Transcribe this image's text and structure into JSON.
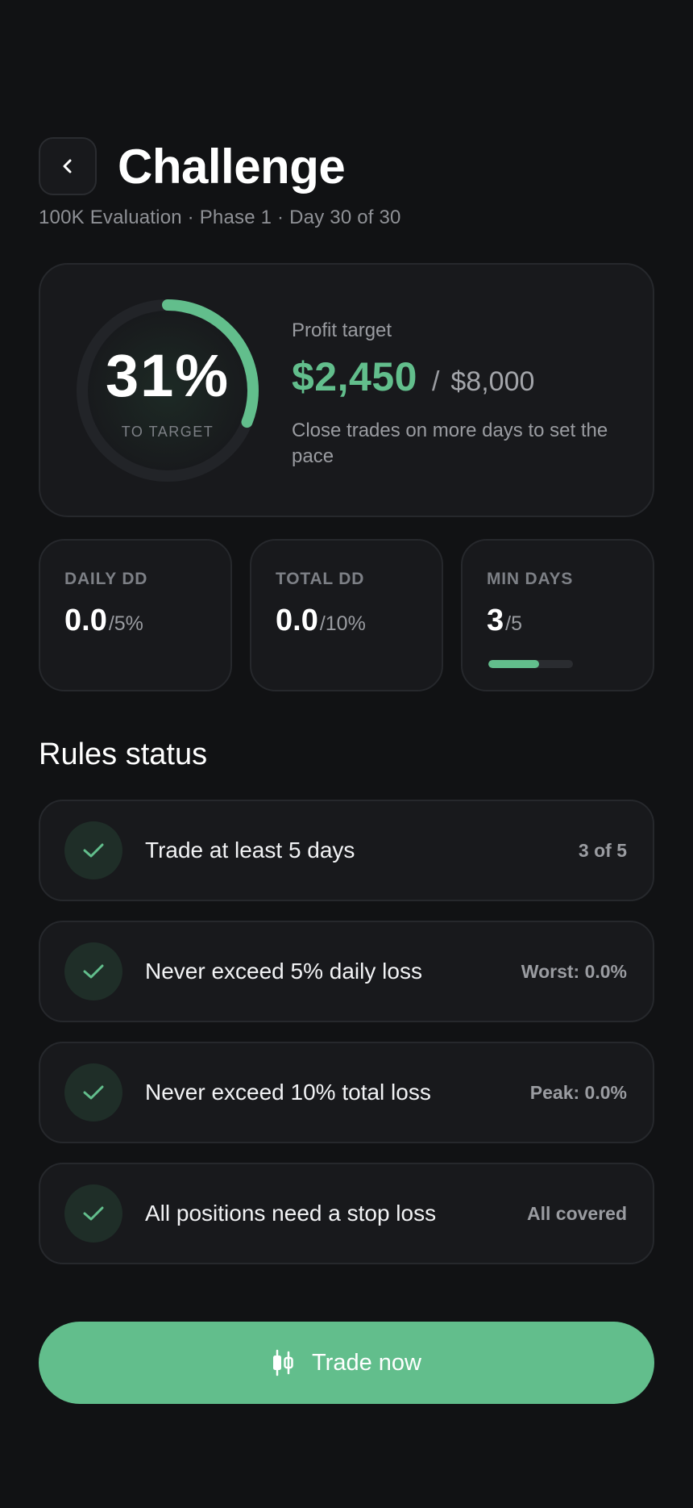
{
  "header": {
    "title": "Challenge",
    "subtitle": "100K Evaluation · Phase 1 · Day 30 of 30"
  },
  "profit": {
    "progress_percent": 31,
    "progress_label": "31%",
    "progress_caption": "TO TARGET",
    "label": "Profit target",
    "current": "$2,450",
    "separator": "/",
    "target": "$8,000",
    "hint": "Close trades on more days to set the pace"
  },
  "stats": [
    {
      "label": "DAILY DD",
      "value": "0.0",
      "limit": "/5%"
    },
    {
      "label": "TOTAL DD",
      "value": "0.0",
      "limit": "/10%"
    },
    {
      "label": "MIN DAYS",
      "value": "3",
      "limit": "/5",
      "progress_fraction": 0.6
    }
  ],
  "rules": {
    "title": "Rules status",
    "items": [
      {
        "text": "Trade at least 5 days",
        "status": "3 of 5",
        "passed": true
      },
      {
        "text": "Never exceed 5% daily loss",
        "status": "Worst: 0.0%",
        "passed": true
      },
      {
        "text": "Never exceed 10% total loss",
        "status": "Peak: 0.0%",
        "passed": true
      },
      {
        "text": "All positions need a stop loss",
        "status": "All covered",
        "passed": true
      }
    ]
  },
  "cta": {
    "label": "Trade now",
    "icon": "candlestick-icon"
  },
  "colors": {
    "background": "#111214",
    "card": "#18191c",
    "accent": "#62be8c",
    "muted_text": "#9a9ca1"
  }
}
